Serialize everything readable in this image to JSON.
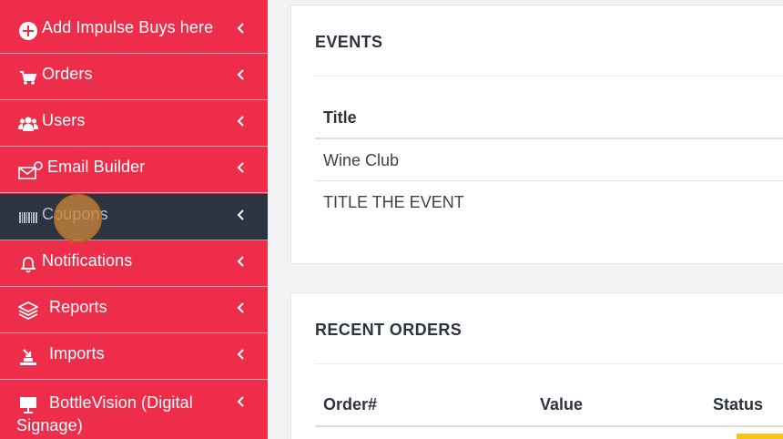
{
  "sidebar": {
    "items": [
      {
        "label": "Add Impulse Buys here",
        "icon": "plus-circle-icon"
      },
      {
        "label": "Orders",
        "icon": "cart-icon"
      },
      {
        "label": "Users",
        "icon": "users-icon"
      },
      {
        "label": "Email Builder",
        "icon": "email-icon"
      },
      {
        "label": "Coupons",
        "icon": "barcode-icon",
        "active": true
      },
      {
        "label": "Notifications",
        "icon": "bell-icon"
      },
      {
        "label": "Reports",
        "icon": "layers-icon"
      },
      {
        "label": "Imports",
        "icon": "import-icon"
      },
      {
        "label_line1": "BottleVision (Digital",
        "label_line2": "Signage)",
        "icon": "monitor-icon"
      }
    ]
  },
  "events": {
    "title": "EVENTS",
    "column_title": "Title",
    "rows": [
      "Wine Club",
      "TITLE THE EVENT"
    ]
  },
  "recent_orders": {
    "title": "RECENT ORDERS",
    "columns": [
      "Order#",
      "Value",
      "Status"
    ]
  },
  "colors": {
    "sidebar_bg": "#ee2d4a",
    "active_bg": "#2b3542",
    "status_accent": "#f5c518"
  }
}
